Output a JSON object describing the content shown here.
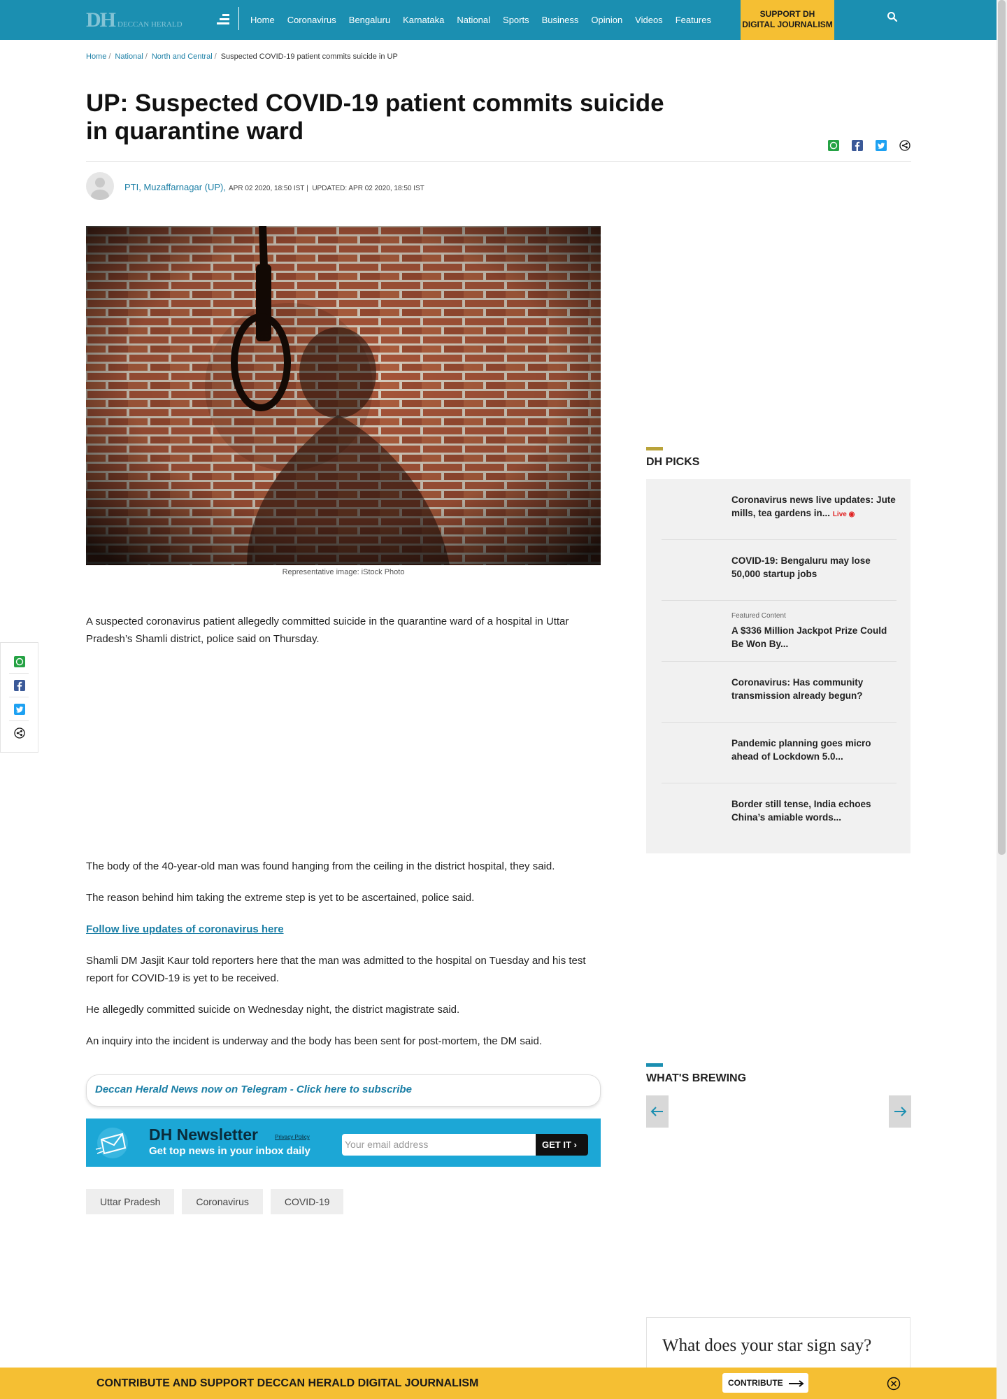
{
  "header": {
    "logo_text": "DH",
    "logo_name": "DECCAN HERALD",
    "nav": [
      "Home",
      "Coronavirus",
      "Bengaluru",
      "Karnataka",
      "National",
      "Sports",
      "Business",
      "Opinion",
      "Videos",
      "Features"
    ],
    "support_line1": "SUPPORT DH",
    "support_line2": "DIGITAL JOURNALISM"
  },
  "breadcrumb": {
    "home": "Home",
    "national": "National",
    "north_central": "North and Central",
    "current": "Suspected COVID-19 patient commits suicide in UP"
  },
  "article": {
    "title": "UP: Suspected COVID-19 patient commits suicide in quarantine ward",
    "author": "PTI, Muzaffarnagar (UP),",
    "published": "Apr 02 2020, 18:50 ist",
    "updated": "Updated: Apr 02 2020, 18:50 ist",
    "caption": "Representative image: iStock Photo",
    "p1": "A suspected coronavirus patient allegedly committed suicide in the quarantine ward of a hospital in Uttar Pradesh’s Shamli district, police said on Thursday.",
    "p2": "The body of the 40-year-old man was found hanging from the ceiling in the district hospital, they said.",
    "p3": "The reason behind him taking the extreme step is yet to be ascertained, police said.",
    "link": "Follow live updates of coronavirus here",
    "p4": "Shamli DM Jasjit Kaur told reporters here that the man was admitted to the hospital on Tuesday and his test report for COVID-19 is yet to be received.",
    "p5": "He allegedly committed suicide on Wednesday night, the district magistrate said.",
    "p6": "An inquiry into the incident is underway and the body has been sent for post-mortem, the DM said."
  },
  "telegram": "Deccan Herald News now on Telegram - Click here to subscribe",
  "newsletter": {
    "title": "DH Newsletter",
    "subtitle": "Get top news in your inbox daily",
    "privacy": "Privacy Policy",
    "placeholder": "Your email address",
    "button": "GET IT"
  },
  "tags": [
    "Uttar Pradesh",
    "Coronavirus",
    "COVID-19"
  ],
  "sidebar": {
    "picks_title": "DH PICKS",
    "picks": [
      {
        "label": "",
        "text": "Coronavirus news live updates: Jute mills, tea gardens in...",
        "live": "Live"
      },
      {
        "label": "",
        "text": "COVID-19: Bengaluru may lose 50,000 startup jobs",
        "live": ""
      },
      {
        "label": "Featured Content",
        "text": "A $336 Million Jackpot Prize Could Be Won By...",
        "live": ""
      },
      {
        "label": "",
        "text": "Coronavirus: Has community transmission already begun?",
        "live": ""
      },
      {
        "label": "",
        "text": "Pandemic planning goes micro ahead of Lockdown 5.0...",
        "live": ""
      },
      {
        "label": "",
        "text": "Border still tense, India echoes China’s amiable words...",
        "live": ""
      }
    ],
    "brewing_title": "WHAT'S BREWING",
    "star_title": "What does your star sign say?"
  },
  "bottom_bar": {
    "text": "CONTRIBUTE AND SUPPORT DECCAN HERALD DIGITAL JOURNALISM",
    "button": "CONTRIBUTE"
  },
  "colors": {
    "brand": "#1b8fb1",
    "support": "#f5bf33",
    "link": "#1b7fa6",
    "picks_accent": "#b9a33a",
    "brewing_accent": "#1b8fb1"
  }
}
